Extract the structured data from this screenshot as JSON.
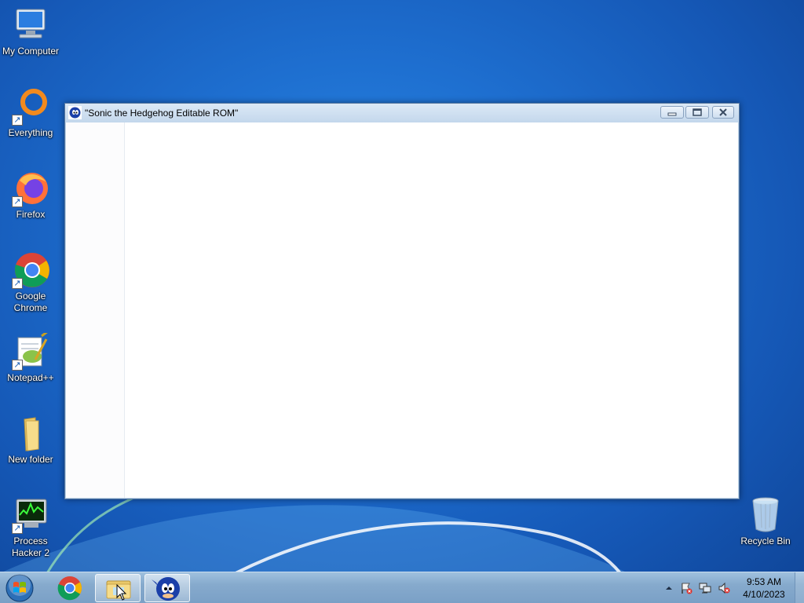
{
  "desktop": {
    "icons": [
      {
        "label": "My Computer",
        "icon": "computer-icon"
      },
      {
        "label": "Everything",
        "icon": "everything-search-icon"
      },
      {
        "label": "Firefox",
        "icon": "firefox-icon"
      },
      {
        "label": "Google Chrome",
        "icon": "chrome-icon"
      },
      {
        "label": "Notepad++",
        "icon": "notepadpp-icon"
      },
      {
        "label": "New folder",
        "icon": "folder-icon"
      },
      {
        "label": "Process Hacker 2",
        "icon": "process-hacker-icon"
      },
      {
        "label": "Recycle Bin",
        "icon": "recycle-bin-icon"
      }
    ]
  },
  "window": {
    "title": "\"Sonic the Hedgehog Editable ROM\"",
    "icon": "sonic-icon"
  },
  "taskbar": {
    "items": [
      {
        "name": "start-button",
        "icon": "windows-logo-icon"
      },
      {
        "name": "chrome",
        "icon": "chrome-icon"
      },
      {
        "name": "explorer",
        "icon": "folder-icon"
      },
      {
        "name": "sonic",
        "icon": "sonic-icon"
      }
    ],
    "tray_icons": [
      "show-hidden-icons-arrow",
      "action-center-flag-icon",
      "network-icon",
      "volume-muted-icon"
    ],
    "clock": {
      "time": "9:53 AM",
      "date": "4/10/2023"
    }
  },
  "colors": {
    "desktop_blue": "#1e6fd0",
    "window_frame": "#bcd3ea",
    "taskbar": "#86aacd"
  }
}
